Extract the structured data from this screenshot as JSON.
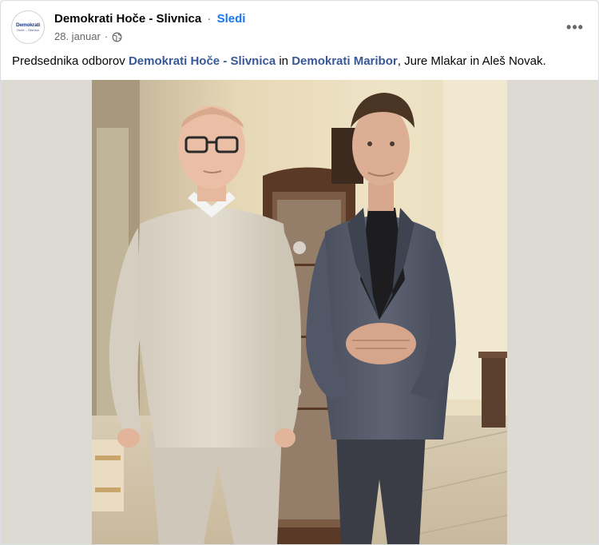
{
  "post": {
    "avatar": {
      "logo_main": "Demokrati",
      "logo_sub": "Hoče – Slivnica"
    },
    "page_name": "Demokrati Hoče - Slivnica",
    "separator": "·",
    "follow_label": "Sledi",
    "date": "28. januar",
    "audience_icon": "globe-icon",
    "more_icon": "more-options-icon",
    "more_label": "•••",
    "caption": {
      "text_1": "Predsednika odborov ",
      "link_1": "Demokrati Hoče - Slivnica",
      "text_2": " in ",
      "link_2": "Demokrati Maribor",
      "text_3": ", Jure Mlakar in Aleš Novak."
    }
  },
  "colors": {
    "link": "#385898",
    "follow": "#1877f2",
    "photo_backdrop": "#dcdad3"
  }
}
